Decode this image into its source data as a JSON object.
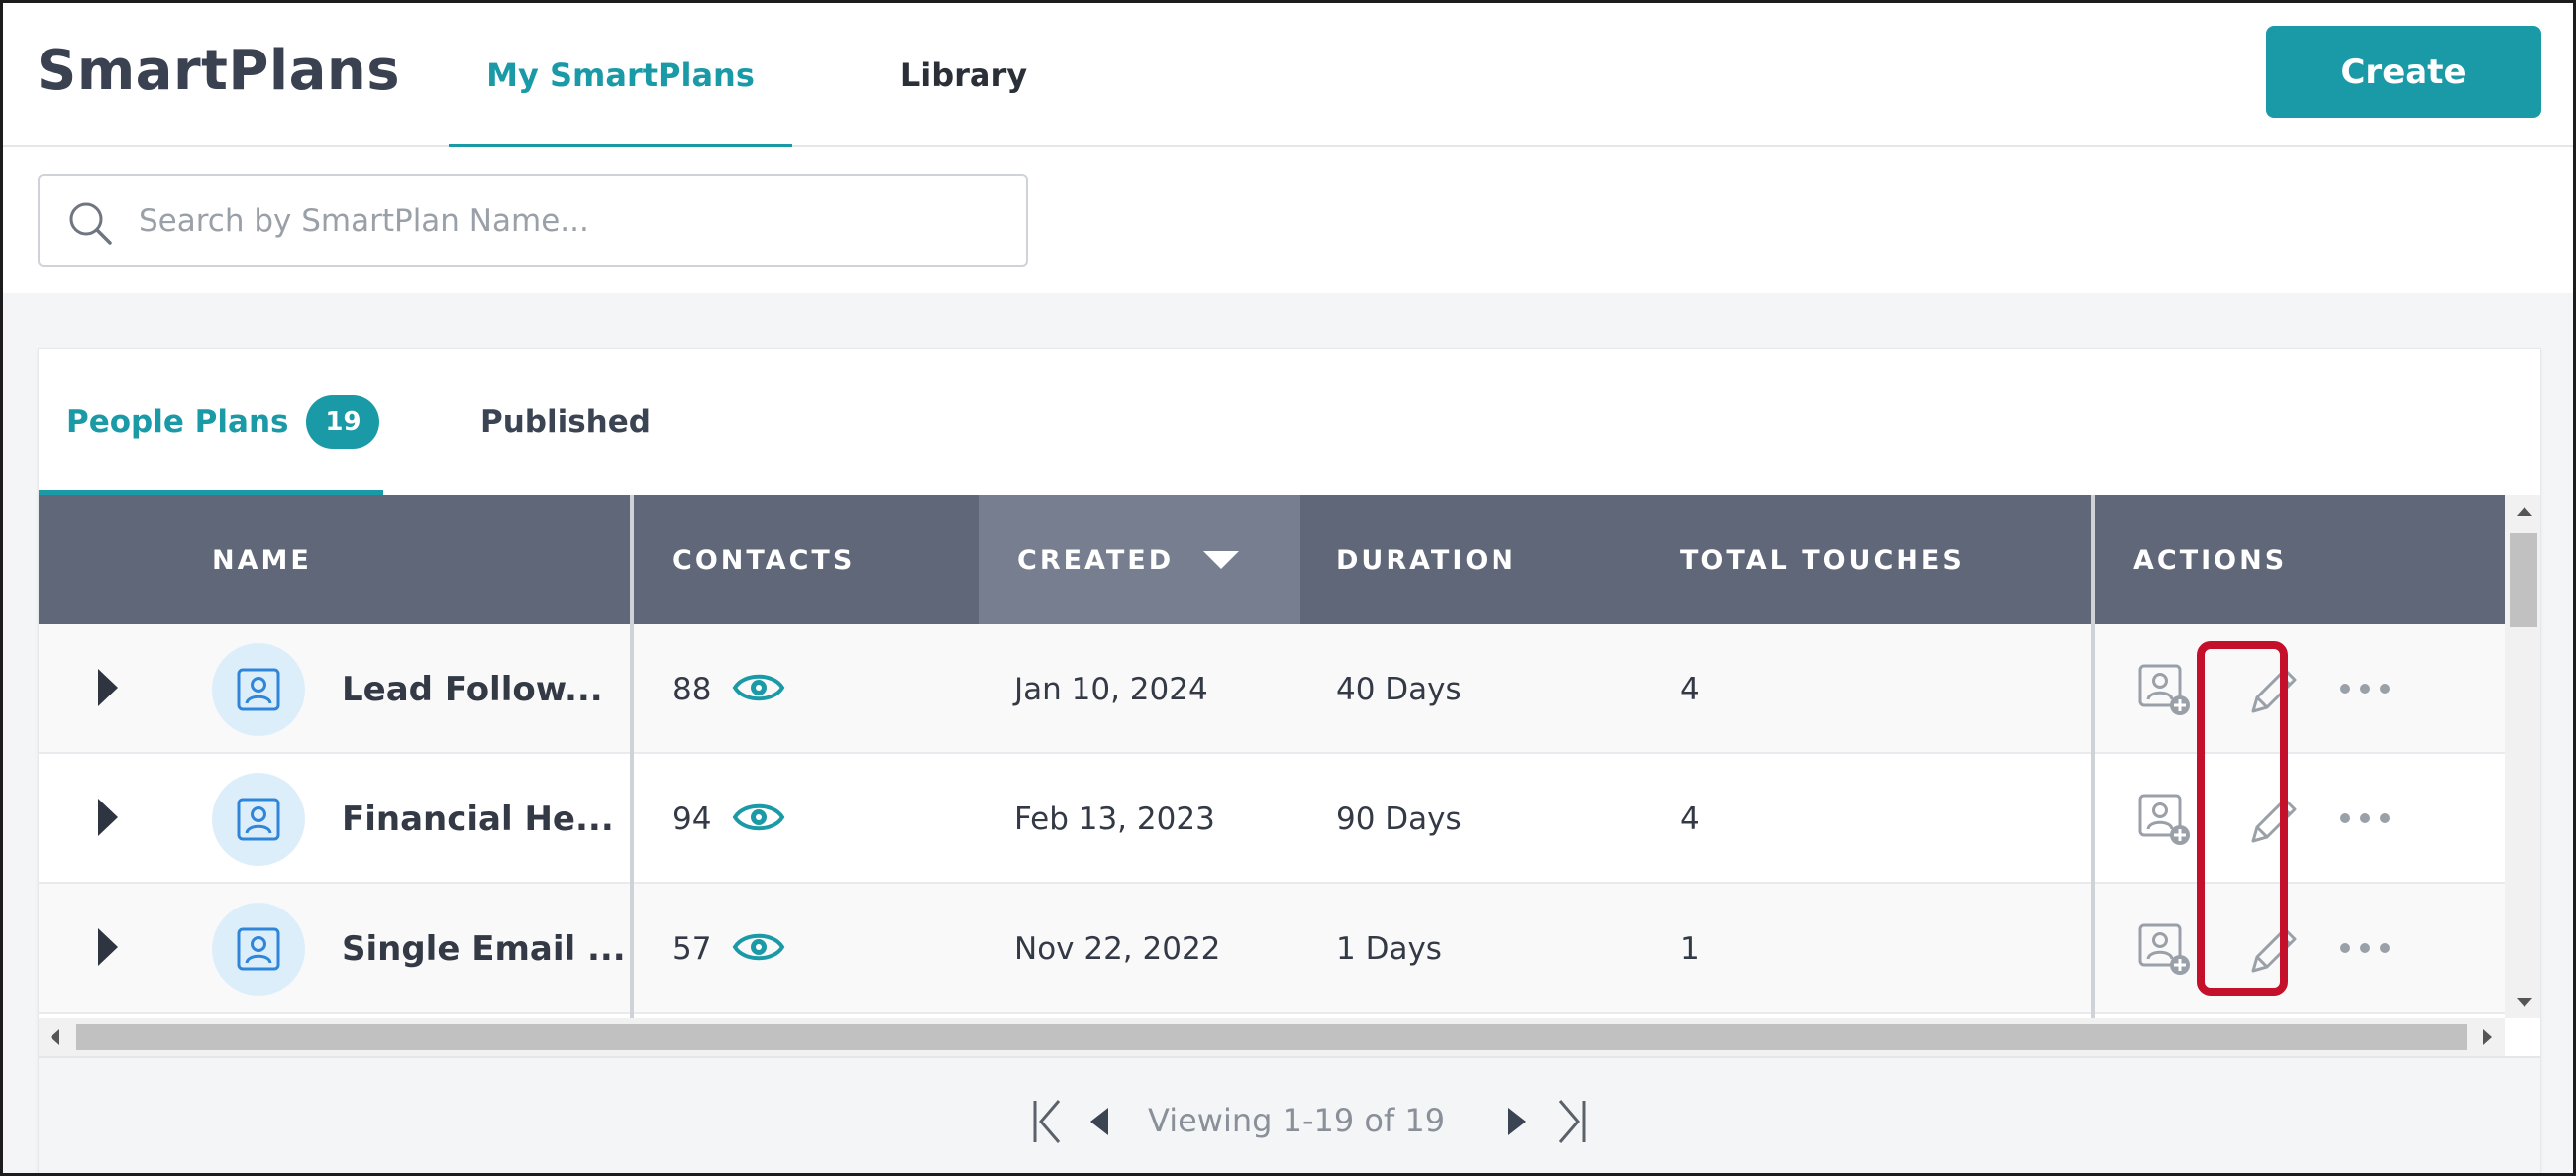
{
  "header": {
    "app_title": "SmartPlans",
    "tabs": [
      {
        "label": "My SmartPlans",
        "active": true
      },
      {
        "label": "Library",
        "active": false
      }
    ],
    "create_label": "Create"
  },
  "search": {
    "placeholder": "Search by SmartPlan Name...",
    "value": ""
  },
  "sub_tabs": [
    {
      "label": "People Plans",
      "count": "19",
      "active": true
    },
    {
      "label": "Published",
      "active": false
    }
  ],
  "table": {
    "columns": {
      "name": "NAME",
      "contacts": "CONTACTS",
      "created": "CREATED",
      "duration": "DURATION",
      "total_touches": "TOTAL TOUCHES",
      "actions": "ACTIONS"
    },
    "sorted_column": "created",
    "rows": [
      {
        "name": "Lead Follow...",
        "contacts": "88",
        "created": "Jan 10, 2024",
        "duration": "40 Days",
        "touches": "4"
      },
      {
        "name": "Financial He...",
        "contacts": "94",
        "created": "Feb 13, 2023",
        "duration": "90 Days",
        "touches": "4"
      },
      {
        "name": "Single Email ...",
        "contacts": "57",
        "created": "Nov 22, 2022",
        "duration": "1 Days",
        "touches": "1"
      }
    ]
  },
  "pagination": {
    "text": "Viewing 1-19 of 19"
  },
  "colors": {
    "accent": "#1a9aa6",
    "header_bg": "#606779",
    "highlight": "#c4102b"
  }
}
